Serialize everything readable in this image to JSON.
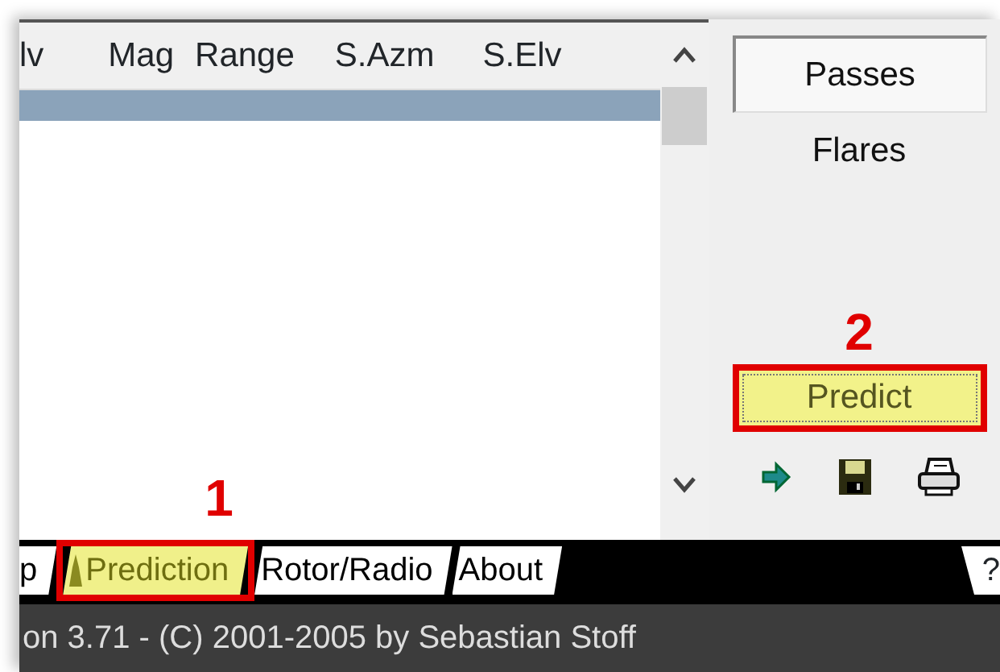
{
  "list": {
    "columns": [
      "lv",
      "Mag",
      "Range",
      "S.Azm",
      "S.Elv"
    ],
    "rows": [
      {
        "selected": true
      }
    ]
  },
  "side_panel": {
    "modes": [
      {
        "label": "Passes",
        "selected": true
      },
      {
        "label": "Flares",
        "selected": false
      }
    ],
    "predict_button": {
      "label": "Predict",
      "focused": true
    }
  },
  "tabs": [
    {
      "label": "p",
      "selected": false
    },
    {
      "label": "Prediction",
      "selected": true
    },
    {
      "label": "Rotor/Radio",
      "selected": false
    },
    {
      "label": "About",
      "selected": false
    }
  ],
  "help": "?",
  "status_bar": "on 3.71 - (C) 2001-2005 by Sebastian Stoff",
  "annotations": [
    {
      "label": "1",
      "kind": "tab"
    },
    {
      "label": "2",
      "kind": "button"
    }
  ]
}
